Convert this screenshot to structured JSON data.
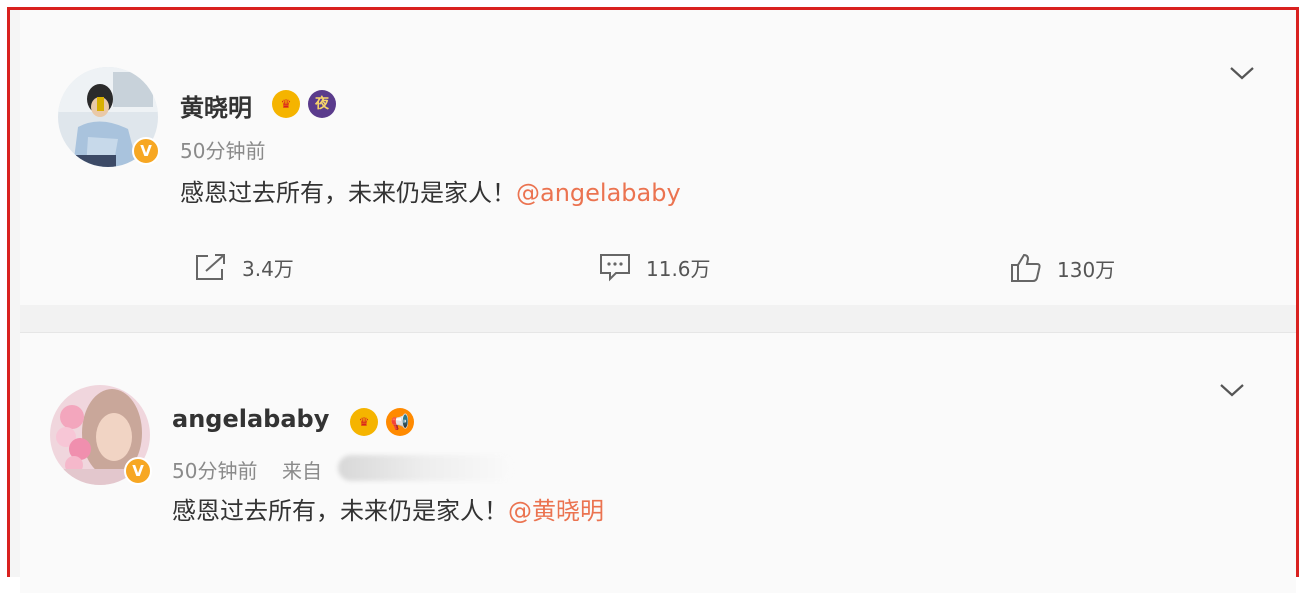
{
  "posts": [
    {
      "username": "黄晓明",
      "time": "50分钟前",
      "source_prefix": "",
      "content_text": "感恩过去所有，未来仍是家人！",
      "mention": "@angelababy",
      "badges": [
        "crown-badge-icon",
        "ye-badge-icon"
      ],
      "ye_badge_char": "夜",
      "actions": {
        "repost": "3.4万",
        "comment": "11.6万",
        "like": "130万"
      }
    },
    {
      "username": "angelababy",
      "time": "50分钟前",
      "source_prefix": "来自",
      "content_text": "感恩过去所有，未来仍是家人！",
      "mention": "@黄晓明",
      "badges": [
        "crown-badge-icon",
        "horn-badge-icon"
      ]
    }
  ],
  "colors": {
    "border": "#d9211f",
    "mention": "#eb7350",
    "verified_badge": "#f7a723"
  }
}
